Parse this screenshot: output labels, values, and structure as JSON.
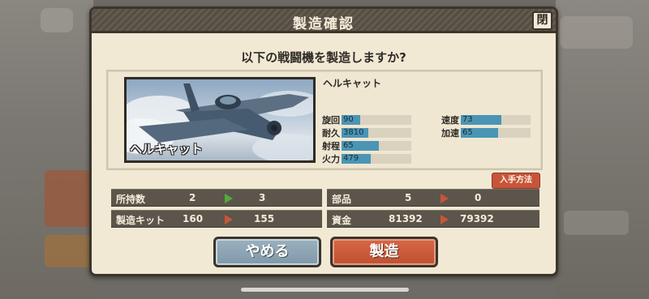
{
  "dialog": {
    "title": "製造確認",
    "close_label": "閉",
    "question": "以下の戦闘機を製造しますか?"
  },
  "aircraft": {
    "name": "ヘルキャット",
    "image_caption": "ヘルキャット",
    "stats": [
      {
        "label": "旋回",
        "value": "90",
        "fill_fraction": 0.27
      },
      {
        "label": "耐久",
        "value": "3810",
        "fill_fraction": 0.38
      },
      {
        "label": "射程",
        "value": "65",
        "fill_fraction": 0.53
      },
      {
        "label": "火力",
        "value": "479",
        "fill_fraction": 0.42
      },
      {
        "label": "速度",
        "value": "73",
        "fill_fraction": 0.58
      },
      {
        "label": "加速",
        "value": "65",
        "fill_fraction": 0.53
      }
    ]
  },
  "obtain_button_label": "入手方法",
  "resources": [
    {
      "label": "所持数",
      "before": "2",
      "after": "3",
      "arrow": "green"
    },
    {
      "label": "製造キット",
      "before": "160",
      "after": "155",
      "arrow": "red"
    },
    {
      "label": "部品",
      "before": "5",
      "after": "0",
      "arrow": "red"
    },
    {
      "label": "資金",
      "before": "81392",
      "after": "79392",
      "arrow": "red"
    }
  ],
  "buttons": {
    "cancel_label": "やめる",
    "build_label": "製造"
  },
  "colors": {
    "panel_bg": "#f1e9d4",
    "stat_fill": "#4a95b6",
    "accent_red": "#c8553a",
    "accent_green": "#57a93d",
    "cancel_button": "#8aa3b3"
  }
}
